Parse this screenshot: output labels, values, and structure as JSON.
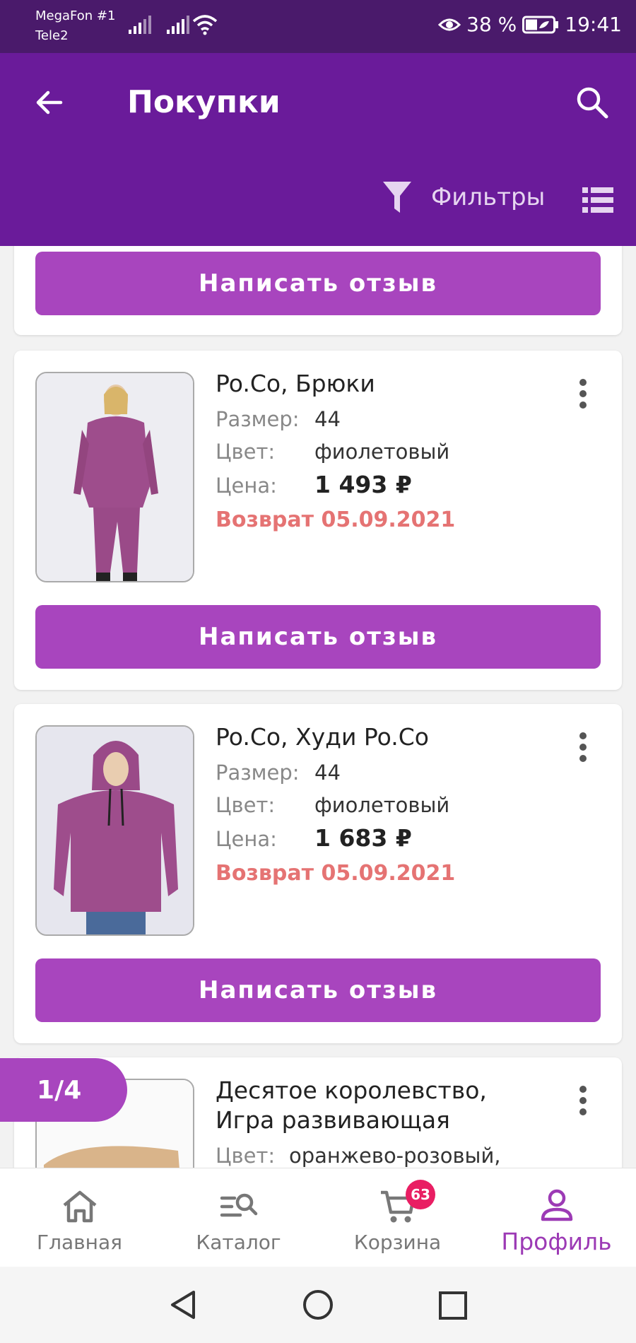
{
  "status_bar": {
    "carrier1": "MegaFon #1",
    "carrier2": "Tele2",
    "battery": "38 %",
    "time": "19:41"
  },
  "app_bar": {
    "title": "Покупки",
    "filter_label": "Фильтры",
    "accent_color": "#6a1b9a"
  },
  "labels": {
    "write_review": "Написать отзыв",
    "size": "Размер:",
    "color": "Цвет:",
    "price": "Цена:"
  },
  "items": [
    {
      "title": "Po.Co, Брюки",
      "size": "44",
      "color": "фиолетовый",
      "price": "1 493 ₽",
      "return": "Возврат 05.09.2021"
    },
    {
      "title": "Po.Co, Худи Po.Co",
      "size": "44",
      "color": "фиолетовый",
      "price": "1 683 ₽",
      "return": "Возврат 05.09.2021"
    },
    {
      "title_line1": "Десятое королевство,",
      "title_line2": "Игра развивающая",
      "color": "оранжево-розовый,"
    }
  ],
  "pager": {
    "label": "1/4"
  },
  "bottom_nav": {
    "home": "Главная",
    "catalog": "Каталог",
    "cart": "Корзина",
    "cart_count": "63",
    "profile": "Профиль"
  }
}
